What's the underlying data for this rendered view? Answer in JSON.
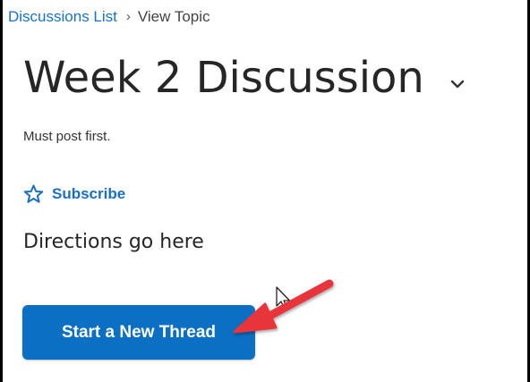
{
  "breadcrumb": {
    "link_label": "Discussions List",
    "separator": "›",
    "current": "View Topic"
  },
  "topic": {
    "title": "Week 2 Discussion",
    "restriction_note": "Must post first.",
    "subscribe_label": "Subscribe",
    "directions": "Directions go here"
  },
  "actions": {
    "start_thread_label": "Start a New Thread"
  },
  "icons": {
    "title_menu": "chevron-down-icon",
    "subscribe": "star-outline-icon",
    "annotation": "red-arrow-annotation",
    "pointer": "mouse-cursor-icon"
  },
  "colors": {
    "link": "#1a73c9",
    "primary_button": "#0b6fc4",
    "annotation_arrow": "#e8363b"
  }
}
